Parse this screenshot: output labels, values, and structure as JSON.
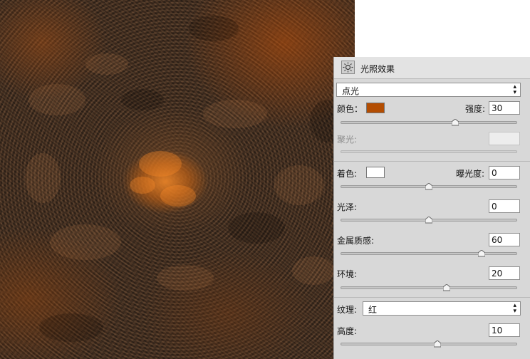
{
  "panel": {
    "title": "光照效果",
    "icon": "light-bulb-icon",
    "light_type": "点光",
    "color_label": "颜色：",
    "color_value": "#b34d02",
    "intensity_label": "强度:",
    "intensity": "30",
    "intensity_level": 0.65,
    "hotspot_label": "聚光:",
    "hotspot_level": 0.0,
    "colorize_label": "着色:",
    "colorize_color": "#ffffff",
    "exposure_label": "曝光度:",
    "exposure": "0",
    "exposure_level": 0.5,
    "gloss_label": "光泽:",
    "gloss": "0",
    "gloss_level": 0.5,
    "metallic_label": "金属质感:",
    "metallic": "60",
    "metallic_level": 0.8,
    "ambience_label": "环境:",
    "ambience": "20",
    "ambience_level": 0.6,
    "texture_label": "纹理:",
    "texture_channel": "红",
    "height_label": "高度:",
    "height": "10",
    "height_level": 0.55
  }
}
